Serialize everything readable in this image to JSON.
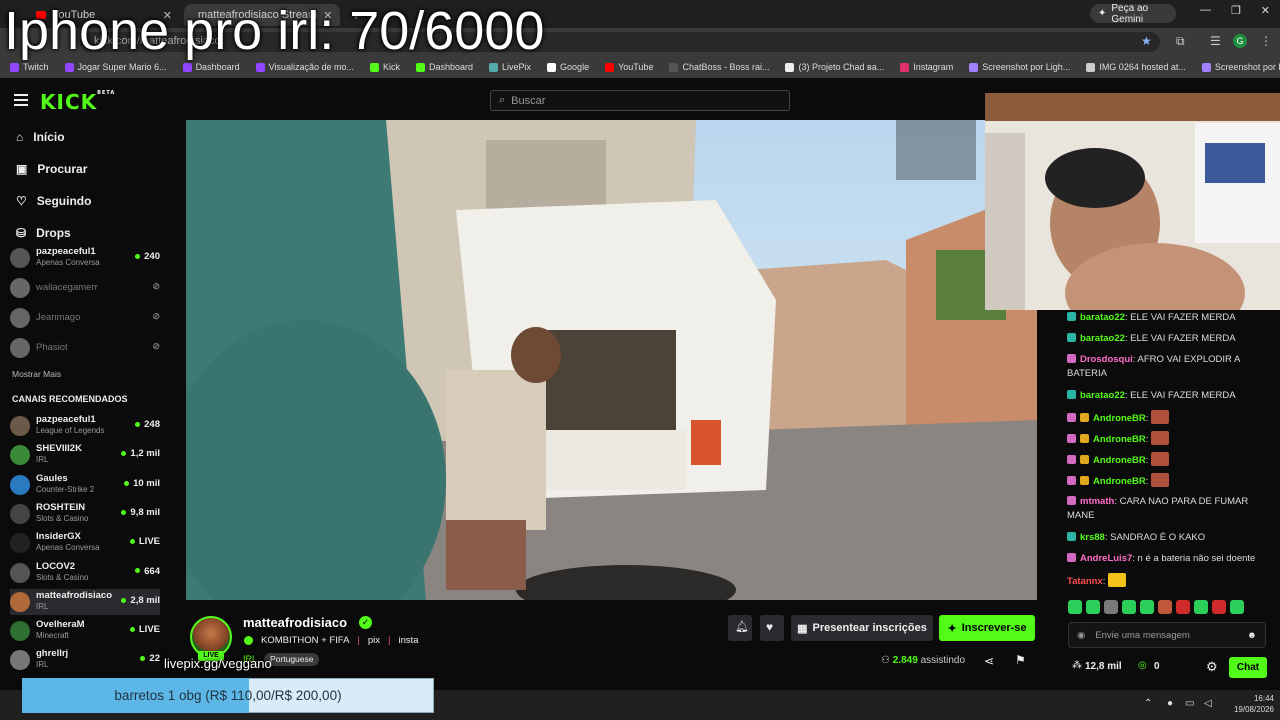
{
  "overlay": {
    "title": "Iphone pro irl: 70/6000"
  },
  "browser": {
    "tabs": [
      {
        "label": "YouTube",
        "color": "#ff0000"
      },
      {
        "label": "matteafrodisiaco Stream",
        "color": "#53fc18"
      }
    ],
    "url": "kick.com/matteafrodisiaco",
    "gemini_label": "Peça ao Gemini",
    "profile_initial": "G",
    "bookmarks": [
      "Twitch",
      "Jogar Super Mario 6...",
      "Dashboard",
      "Visualização de mo...",
      "Kick",
      "Dashboard",
      "LivePix",
      "Google",
      "YouTube",
      "ChatBoss - Boss rai...",
      "(3) Projeto Chad ва...",
      "Instagram",
      "Screenshot por Ligh...",
      "IMG 0264 hosted at...",
      "Screenshot por Ligh..."
    ]
  },
  "kick": {
    "logo": "KICK",
    "logo_badge": "BETA",
    "search_placeholder": "Buscar",
    "nav": [
      {
        "label": "Início",
        "icon": "home-icon",
        "glyph": "⌂"
      },
      {
        "label": "Procurar",
        "icon": "browse-icon",
        "glyph": "▣"
      },
      {
        "label": "Seguindo",
        "icon": "heart-icon",
        "glyph": "♡"
      },
      {
        "label": "Drops",
        "icon": "drops-icon",
        "glyph": "⛁"
      }
    ],
    "following": [
      {
        "name": "pazpeaceful1",
        "game": "Apenas Conversa",
        "viewers": "240",
        "online": true
      },
      {
        "name": "wallacegamerr",
        "game": "",
        "viewers": "",
        "online": false
      },
      {
        "name": "Jeanmago",
        "game": "",
        "viewers": "",
        "online": false
      },
      {
        "name": "Phasiot",
        "game": "",
        "viewers": "",
        "online": false
      }
    ],
    "show_more": "Mostrar Mais",
    "recommended_label": "CANAIS RECOMENDADOS",
    "recommended": [
      {
        "name": "pazpeaceful1",
        "game": "League of Legends",
        "viewers": "248",
        "color": "#6b5a4a"
      },
      {
        "name": "SHEVIII2K",
        "game": "IRL",
        "viewers": "1,2 mil",
        "color": "#3a8a3a"
      },
      {
        "name": "Gaules",
        "game": "Counter-Strike 2",
        "viewers": "10 mil",
        "color": "#2a7ac0"
      },
      {
        "name": "ROSHTEIN",
        "game": "Slots & Casino",
        "viewers": "9,8 mil",
        "color": "#444"
      },
      {
        "name": "InsiderGX",
        "game": "Apenas Conversa",
        "viewers": "LIVE",
        "color": "#222"
      },
      {
        "name": "LOCOV2",
        "game": "Slots & Casino",
        "viewers": "664",
        "color": "#555"
      },
      {
        "name": "matteafrodisiaco",
        "game": "IRL",
        "viewers": "2,8 mil",
        "color": "#b06a3a"
      },
      {
        "name": "OvelheraM",
        "game": "Minecraft",
        "viewers": "LIVE",
        "color": "#2f6f2f"
      },
      {
        "name": "ghrellrj",
        "game": "IRL",
        "viewers": "22",
        "color": "#777"
      }
    ]
  },
  "stream": {
    "streamer": "matteafrodisiaco",
    "live_label": "LIVE",
    "title_parts": [
      "KOMBITHON + FIFA",
      "pix",
      "insta"
    ],
    "category": "IRL",
    "language": "Portuguese",
    "gift_label": "Presentear inscrições",
    "subscribe_label": "Inscrever-se",
    "viewers": "2.849",
    "viewers_suffix": "assistindo"
  },
  "chat": {
    "messages": [
      {
        "user": "baratao22",
        "text": "ELE VAI FAZER MERDA",
        "color": "#53fc18",
        "badge": "#2bb5a5"
      },
      {
        "user": "baratao22",
        "text": "ELE VAI FAZER MERDA",
        "color": "#53fc18",
        "badge": "#2bb5a5"
      },
      {
        "user": "Drosdosqui",
        "text": "AFRO VAI EXPLODIR A BATERIA",
        "color": "#ff6ec7",
        "badge": "#d36ac2"
      },
      {
        "user": "baratao22",
        "text": "ELE VAI FAZER MERDA",
        "color": "#53fc18",
        "badge": "#2bb5a5"
      },
      {
        "user": "AndroneBR",
        "text": "",
        "color": "#53fc18",
        "badge": "#d36ac2"
      },
      {
        "user": "AndroneBR",
        "text": "",
        "color": "#53fc18",
        "badge": "#d36ac2"
      },
      {
        "user": "AndroneBR",
        "text": "",
        "color": "#53fc18",
        "badge": "#d36ac2"
      },
      {
        "user": "AndroneBR",
        "text": "",
        "color": "#53fc18",
        "badge": "#d36ac2"
      },
      {
        "user": "mtmath",
        "text": "CARA NAO PARA DE FUMAR MANE",
        "color": "#ff6ec7",
        "badge": "#d36ac2"
      },
      {
        "user": "krs88",
        "text": "SANDRAO É O KAKO",
        "color": "#53fc18",
        "badge": "#2bb5a5"
      },
      {
        "user": "AndreLuis7",
        "text": "n é a bateria não sei doente",
        "color": "#ff6ec7",
        "badge": "#d36ac2"
      },
      {
        "user": "Tatannx",
        "text": "",
        "color": "#ff4e4e",
        "badge": ""
      }
    ],
    "input_placeholder": "Envie uma mensagem",
    "kicks": "12,8 mil",
    "points": "0",
    "chat_button": "Chat"
  },
  "overlays": {
    "livepix": "livepix.gg/veggano",
    "goal_text": "barretos 1 obg (R$ 110,00/R$ 200,00)",
    "goal_progress": 0.55
  },
  "taskbar": {
    "time": "16:44",
    "date": "19/08/2026"
  }
}
